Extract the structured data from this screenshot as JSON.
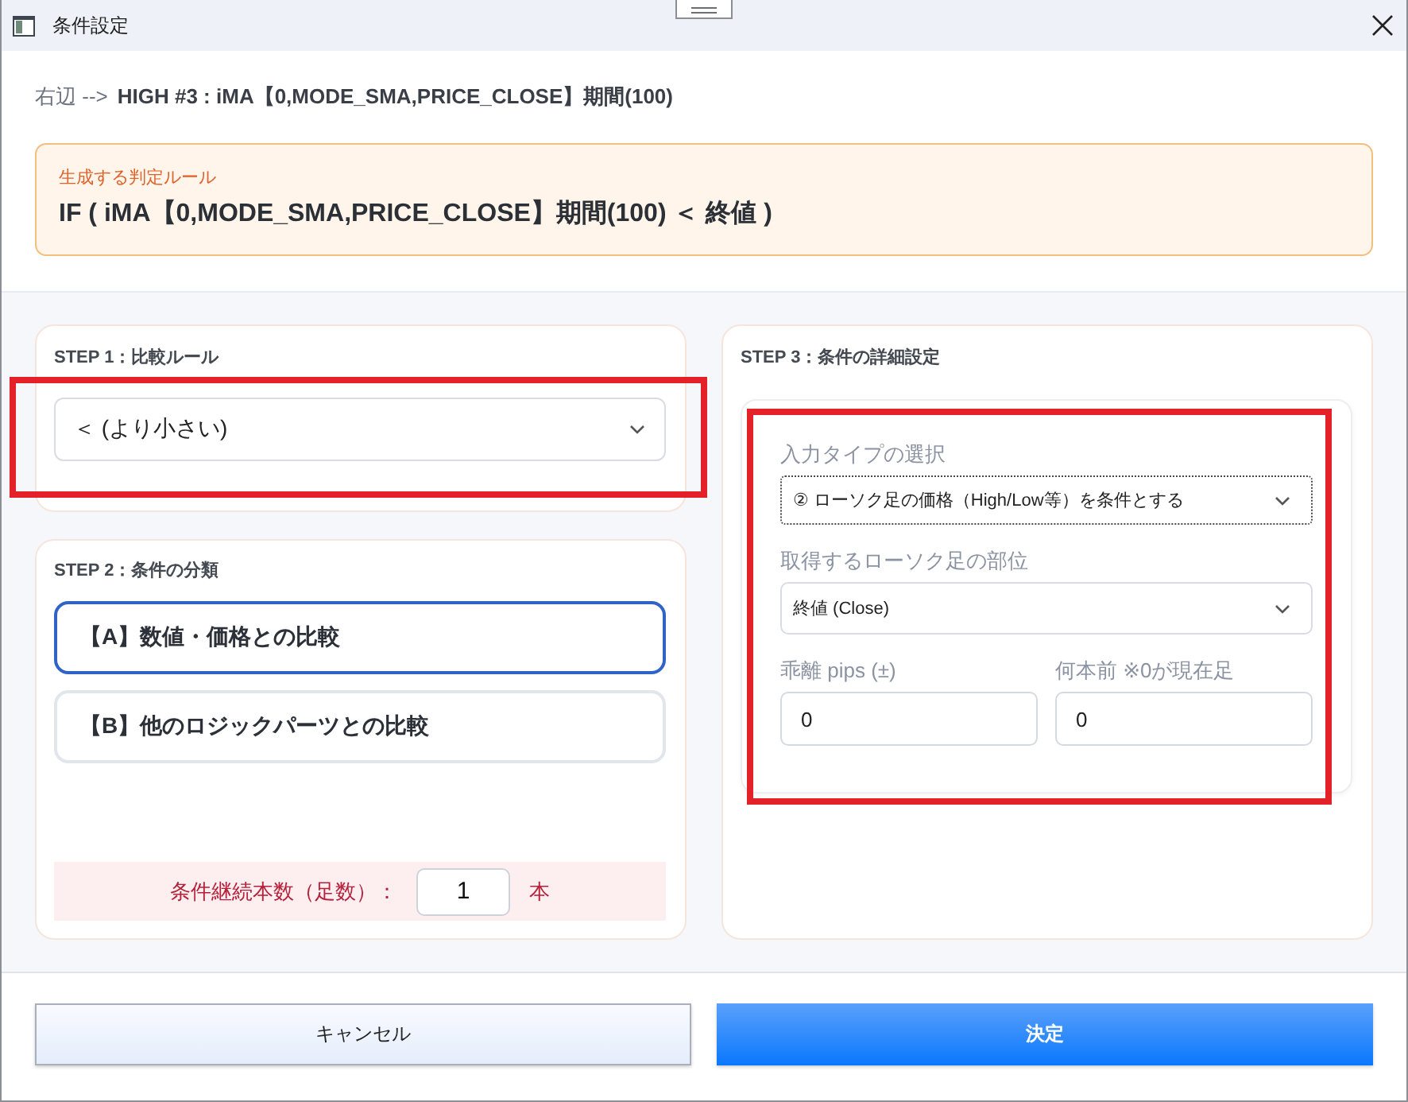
{
  "window": {
    "title": "条件設定"
  },
  "header": {
    "breadcrumb_label": "右辺 -->",
    "breadcrumb_value": "HIGH #3 : iMA【0,MODE_SMA,PRICE_CLOSE】期間(100)",
    "rule_label": "生成する判定ルール",
    "rule": "IF ( iMA【0,MODE_SMA,PRICE_CLOSE】期間(100) ＜ 終値 )"
  },
  "step1": {
    "title": "STEP 1：比較ルール",
    "highlighted": true,
    "select": {
      "value": "＜ (より小さい)"
    }
  },
  "step2": {
    "title": "STEP 2：条件の分類",
    "options": [
      {
        "label": "【A】数値・価格との比較",
        "selected": true
      },
      {
        "label": "【B】他のロジックパーツとの比較",
        "selected": false
      }
    ],
    "count": {
      "label": "条件継続本数（足数）：",
      "value": "1",
      "unit": "本"
    }
  },
  "step3": {
    "title": "STEP 3：条件の詳細設定",
    "highlighted": true,
    "fields": [
      {
        "kind": "select",
        "label": "入力タイプの選択",
        "value": "② ローソク足の価格（High/Low等）を条件とする",
        "focused": true
      },
      {
        "kind": "select",
        "label": "取得するローソク足の部位",
        "value": "終値 (Close)",
        "focused": false
      },
      {
        "kind": "input",
        "label": "乖離 pips (±)",
        "value": "0"
      },
      {
        "kind": "input",
        "label": "何本前 ※0が現在足",
        "value": "0"
      }
    ]
  },
  "buttons": [
    {
      "kind": "secondary",
      "label": "キャンセル"
    },
    {
      "kind": "primary",
      "label": "決定"
    }
  ]
}
